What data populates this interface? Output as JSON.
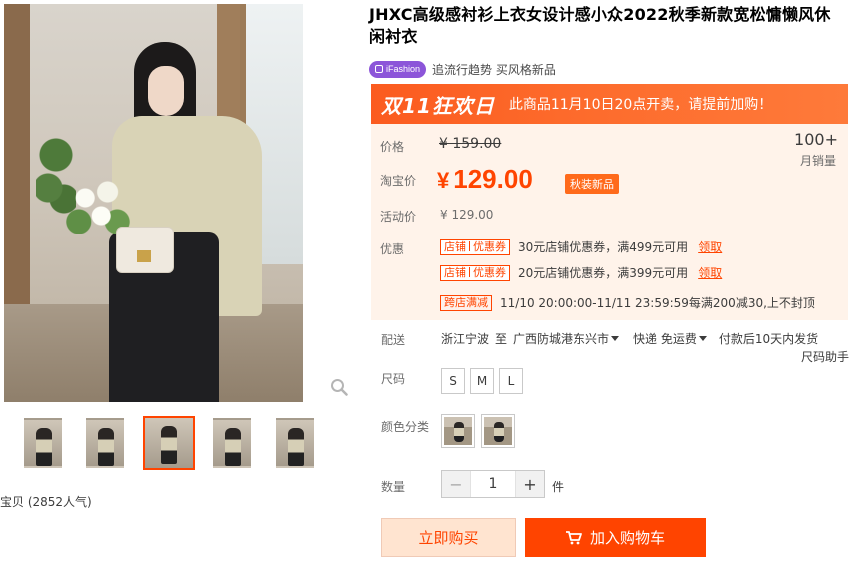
{
  "product": {
    "title": "JHXC高级感衬衫上衣女设计感小众2022秋季新款宽松慵懒风休闲衬衣",
    "brand_badge": "iFashion",
    "brand_slogan": "追流行趋势 买风格新品"
  },
  "promo": {
    "logo_text": "双11狂欢日",
    "message": "此商品11月10日20点开卖，请提前加购！"
  },
  "price": {
    "label_price": "价格",
    "original": "¥ 159.00",
    "label_taobao": "淘宝价",
    "currency": "¥",
    "current": "129.00",
    "tag": "秋装新品",
    "label_activity": "活动价",
    "activity": "¥ 129.00",
    "sales_count": "100+",
    "sales_label": "月销量"
  },
  "discounts": {
    "label": "优惠",
    "coupons": [
      {
        "tag_left": "店铺",
        "tag_right": "优惠券",
        "text": "30元店铺优惠券，满499元可用",
        "link": "领取"
      },
      {
        "tag_left": "店铺",
        "tag_right": "优惠券",
        "text": "20元店铺优惠券，满399元可用",
        "link": "领取"
      }
    ],
    "cross_store": {
      "tag": "跨店满减",
      "text": "11/10 20:00:00-11/11 23:59:59每满200减30,上不封顶"
    }
  },
  "delivery": {
    "label": "配送",
    "from": "浙江宁波",
    "to_word": "至",
    "destination": "广西防城港东兴市",
    "shipping": "快递 免运费",
    "promise": "付款后10天内发货"
  },
  "size": {
    "label": "尺码",
    "help": "尺码助手",
    "options": [
      "S",
      "M",
      "L"
    ]
  },
  "color": {
    "label": "颜色分类"
  },
  "quantity": {
    "label": "数量",
    "minus": "−",
    "value": "1",
    "plus": "+",
    "unit": "件"
  },
  "actions": {
    "buy_now": "立即购买",
    "add_cart": "加入购物车"
  },
  "gallery": {
    "popularity": "宝贝 (2852人气)"
  },
  "colors": {
    "accent": "#ff4400",
    "banner": "#fb5b1f",
    "price_bg": "#fff3ea",
    "brand_badge": "#8c55d9"
  }
}
